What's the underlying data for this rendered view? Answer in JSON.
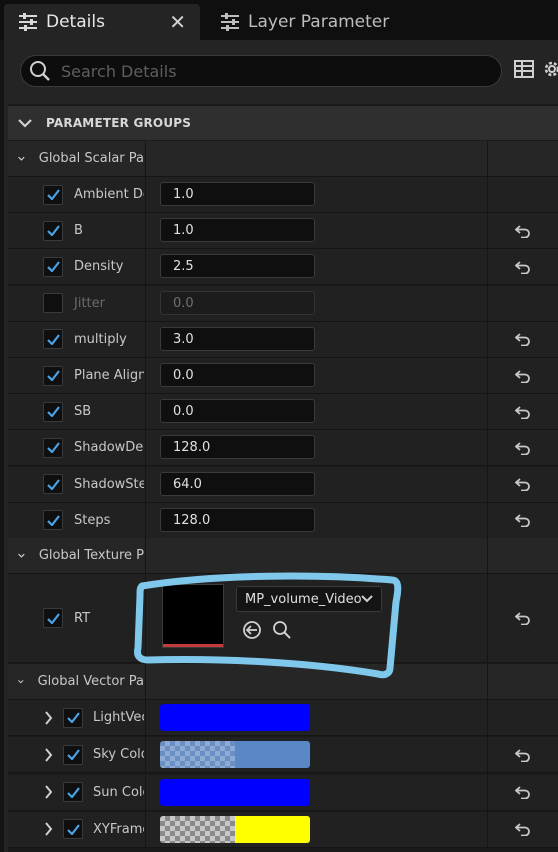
{
  "tabs": {
    "details_label": "Details",
    "close_glyph": "✕",
    "layer_param_label": "Layer Parameter"
  },
  "search": {
    "placeholder": "Search Details"
  },
  "section": {
    "title": "PARAMETER GROUPS"
  },
  "groups": {
    "scalar": "Global Scalar Pa",
    "texture": "Global Texture P",
    "vector": "Global Vector Pa"
  },
  "scalar_params": [
    {
      "name": "Ambient Den",
      "value": "1.0",
      "checked": true,
      "reset": false
    },
    {
      "name": "B",
      "value": "1.0",
      "checked": true,
      "reset": true
    },
    {
      "name": "Density",
      "value": "2.5",
      "checked": true,
      "reset": true
    },
    {
      "name": "Jitter",
      "value": "0.0",
      "checked": false,
      "reset": false
    },
    {
      "name": "multiply",
      "value": "3.0",
      "checked": true,
      "reset": true
    },
    {
      "name": "Plane Alignm",
      "value": "0.0",
      "checked": true,
      "reset": true
    },
    {
      "name": "SB",
      "value": "0.0",
      "checked": true,
      "reset": true
    },
    {
      "name": "ShadowDen",
      "value": "128.0",
      "checked": true,
      "reset": true
    },
    {
      "name": "ShadowStep",
      "value": "64.0",
      "checked": true,
      "reset": true
    },
    {
      "name": "Steps",
      "value": "128.0",
      "checked": true,
      "reset": true
    }
  ],
  "texture_param": {
    "name": "RT",
    "asset": "MP_volume_Video",
    "checked": true,
    "reset": true
  },
  "vector_params": [
    {
      "name": "LightVec",
      "left_color": "#0000ff",
      "right_color": "#0000ff",
      "left_alpha": "opaque",
      "reset": false
    },
    {
      "name": "Sky Colo",
      "left_color": "#6a8fc4",
      "right_color": "#5a87c6",
      "left_alpha": "checker",
      "reset": true
    },
    {
      "name": "Sun Colo",
      "left_color": "#0000ff",
      "right_color": "#0000ff",
      "left_alpha": "opaque",
      "reset": true
    },
    {
      "name": "XYFrame",
      "left_color": "#c8c8c8",
      "right_color": "#ffff00",
      "left_alpha": "checker",
      "reset": true
    }
  ],
  "annotation_color": "#7fc8ec"
}
